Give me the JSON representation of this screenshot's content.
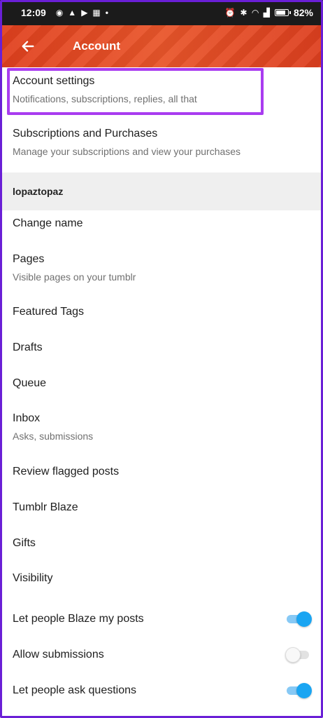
{
  "status_bar": {
    "time": "12:09",
    "battery": "82%",
    "battery_level": 0.82
  },
  "app_bar": {
    "title": "Account"
  },
  "items_top": [
    {
      "title": "Account settings",
      "subtitle": "Notifications, subscriptions, replies, all that"
    },
    {
      "title": "Subscriptions and Purchases",
      "subtitle": "Manage your subscriptions and view your purchases"
    }
  ],
  "section_header": "lopaztopaz",
  "items_blog": [
    {
      "title": "Change name"
    },
    {
      "title": "Pages",
      "subtitle": "Visible pages on your tumblr"
    },
    {
      "title": "Featured Tags"
    },
    {
      "title": "Drafts"
    },
    {
      "title": "Queue"
    },
    {
      "title": "Inbox",
      "subtitle": "Asks, submissions"
    },
    {
      "title": "Review flagged posts"
    },
    {
      "title": "Tumblr Blaze"
    },
    {
      "title": "Gifts"
    },
    {
      "title": "Visibility"
    }
  ],
  "toggles": [
    {
      "label": "Let people Blaze my posts",
      "on": true
    },
    {
      "label": "Allow submissions",
      "on": false
    },
    {
      "label": "Let people ask questions",
      "on": true
    }
  ],
  "colors": {
    "accent_toggle": "#1aa5f2",
    "highlight": "#a93cf0",
    "header": "#e0401e"
  }
}
